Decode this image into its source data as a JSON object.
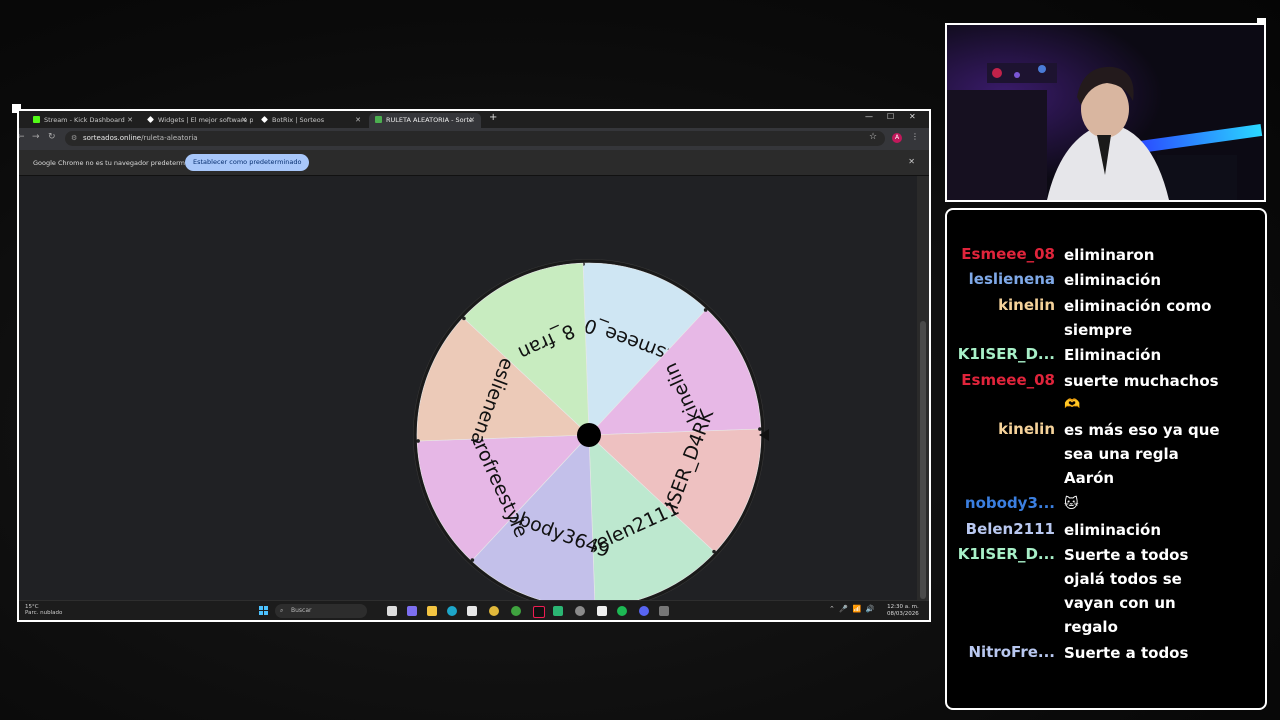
{
  "browser": {
    "tabs": [
      {
        "label": "Stream - Kick Dashboard",
        "icon": "kick-icon",
        "color": "#53fc18"
      },
      {
        "label": "Widgets | El mejor software pa",
        "icon": "widget-icon",
        "color": "#ffffff"
      },
      {
        "label": "BotRix | Sorteos",
        "icon": "botrix-icon",
        "color": "#ffffff"
      },
      {
        "label": "RULETA ALEATORIA - Sorte",
        "icon": "ruleta-icon",
        "color": "#4caf50",
        "active": true
      }
    ],
    "url_host": "sorteados.online",
    "url_path": "/ruleta-aleatoria",
    "infobar_text": "Google Chrome no es tu navegador predeterminado",
    "infobar_button": "Establecer como predeterminado",
    "profile_initial": "A"
  },
  "wheel": {
    "segments": [
      {
        "label": "Esmeee_08",
        "color": "#cfe6f3"
      },
      {
        "label": "kinelin",
        "color": "#e7b8e6"
      },
      {
        "label": "K1ISER_D4RK",
        "color": "#eec1c1"
      },
      {
        "label": "Belen2111",
        "color": "#bde8cf"
      },
      {
        "label": "nobody3649",
        "color": "#c3c0ea"
      },
      {
        "label": "Nitrofreestyle",
        "color": "#e6b7e6"
      },
      {
        "label": "leslienena",
        "color": "#eccab8"
      },
      {
        "label": "8_fran",
        "color": "#c8ecc0"
      }
    ]
  },
  "taskbar": {
    "weather_temp": "15°C",
    "weather_desc": "Parc. nublado",
    "search_label": "Buscar",
    "time": "12:30 a. m.",
    "date": "08/03/2026"
  },
  "chat": {
    "messages": [
      {
        "user": "Esmeee_08",
        "color": "#e0243b",
        "lines": [
          "eliminaron"
        ]
      },
      {
        "user": "leslienena",
        "color": "#7fa9e8",
        "lines": [
          "eliminación"
        ]
      },
      {
        "user": "kinelin",
        "color": "#f5d29a",
        "lines": [
          "eliminación como",
          "siempre"
        ]
      },
      {
        "user": "K1ISER_D...",
        "color": "#a8f0c8",
        "lines": [
          "Eliminación"
        ]
      },
      {
        "user": "Esmeee_08",
        "color": "#e0243b",
        "lines": [
          "suerte muchachos",
          "🫶"
        ]
      },
      {
        "user": "kinelin",
        "color": "#f5d29a",
        "lines": [
          "es más eso ya que",
          "sea una regla",
          "Aarón"
        ]
      },
      {
        "user": "nobody3...",
        "color": "#3b7fe0",
        "lines": [
          "🐱"
        ]
      },
      {
        "user": "Belen2111",
        "color": "#b9c8f0",
        "lines": [
          "eliminación"
        ]
      },
      {
        "user": "K1ISER_D...",
        "color": "#a8f0c8",
        "lines": [
          "Suerte a todos",
          "ojalá todos se",
          "vayan con un",
          "regalo"
        ]
      },
      {
        "user": "NitroFre...",
        "color": "#b9c8f0",
        "lines": [
          "Suerte a todos"
        ]
      }
    ]
  }
}
